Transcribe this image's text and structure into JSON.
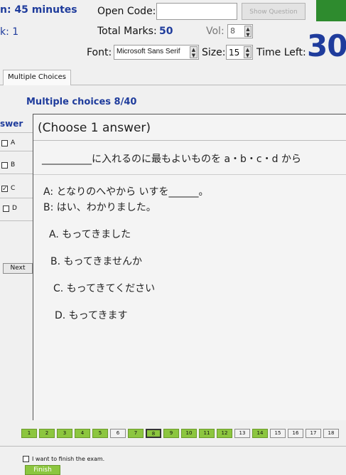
{
  "header": {
    "duration": "n: 45 minutes",
    "rank": "k: 1",
    "open_code_label": "Open Code:",
    "open_code_value": "",
    "show_question_label": "Show Question",
    "total_marks_label": "Total Marks:",
    "total_marks_value": "50",
    "vol_label": "Vol:",
    "vol_value": "8",
    "font_label": "Font:",
    "font_value": "Microsoft Sans Serif",
    "size_label": "Size:",
    "size_value": "15",
    "time_left_label": "Time Left:",
    "time_left_value": "30",
    "accent_color": "#1f3c9c",
    "green_block_color": "#2e8b2e"
  },
  "tabs": [
    {
      "label": "Multiple Choices"
    }
  ],
  "section_title": "Multiple choices 8/40",
  "answer_panel": {
    "title": "swer",
    "choices": [
      {
        "label": "A",
        "checked": false
      },
      {
        "label": "B",
        "checked": false
      },
      {
        "label": "C",
        "checked": true
      },
      {
        "label": "D",
        "checked": false
      }
    ],
    "next_label": "Next"
  },
  "question": {
    "instruction": "(Choose 1 answer)",
    "prompt": "__________に入れるのに最もよいものを a・b・c・d から",
    "line_a": "A:  となりのへやから いすを______。",
    "line_b": "B:  はい、わかりました。",
    "options": [
      "A. もってきました",
      "B. もってきませんか",
      "C. もってきてください",
      "D. もってきます"
    ]
  },
  "navigation": {
    "questions": [
      {
        "num": "1",
        "state": "answered"
      },
      {
        "num": "2",
        "state": "answered"
      },
      {
        "num": "3",
        "state": "answered"
      },
      {
        "num": "4",
        "state": "answered"
      },
      {
        "num": "5",
        "state": "answered"
      },
      {
        "num": "6",
        "state": "empty"
      },
      {
        "num": "7",
        "state": "answered"
      },
      {
        "num": "8",
        "state": "current"
      },
      {
        "num": "9",
        "state": "answered"
      },
      {
        "num": "10",
        "state": "answered"
      },
      {
        "num": "11",
        "state": "answered"
      },
      {
        "num": "12",
        "state": "answered"
      },
      {
        "num": "13",
        "state": "empty"
      },
      {
        "num": "14",
        "state": "answered"
      },
      {
        "num": "15",
        "state": "empty"
      },
      {
        "num": "16",
        "state": "empty"
      },
      {
        "num": "17",
        "state": "empty"
      },
      {
        "num": "18",
        "state": "empty"
      }
    ]
  },
  "footer": {
    "finish_checkbox_label": "I want to finish the exam.",
    "finish_button_label": "Finish"
  }
}
